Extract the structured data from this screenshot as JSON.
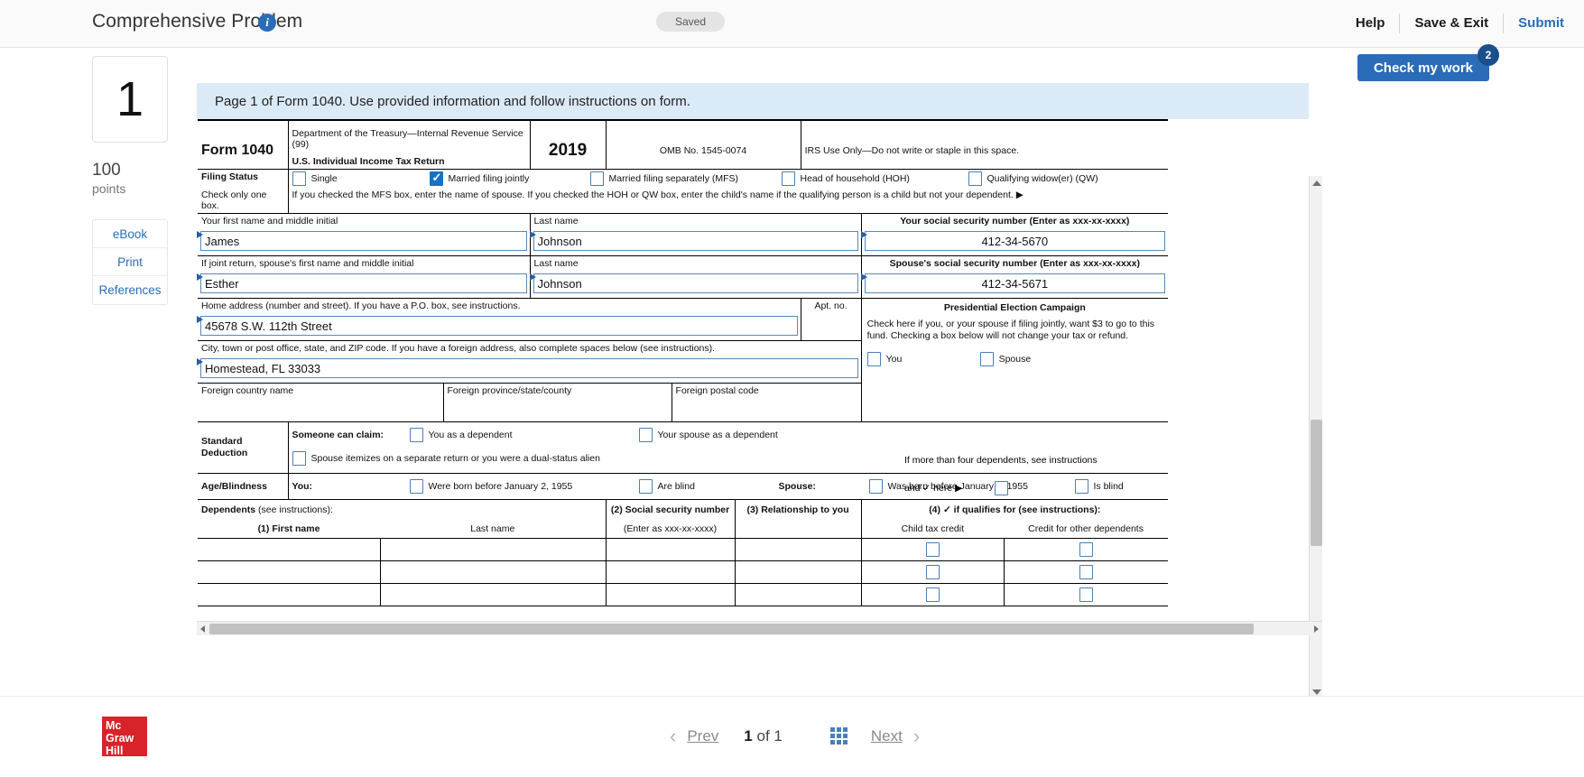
{
  "header": {
    "title": "Comprehensive Problem",
    "info_icon": "info-icon",
    "saved_label": "Saved",
    "nav": {
      "help": "Help",
      "save_exit": "Save & Exit",
      "submit": "Submit"
    }
  },
  "rail": {
    "question_number": "1",
    "points_value": "100",
    "points_label": "points",
    "buttons": [
      "eBook",
      "Print",
      "References"
    ]
  },
  "check_my_work": {
    "label": "Check my work",
    "badge": "2"
  },
  "banner": {
    "text": "Page 1 of Form 1040. Use provided information and follow instructions on form."
  },
  "form": {
    "title": "Form 1040",
    "dept_line1": "Department of the Treasury—Internal Revenue Service (99)",
    "dept_line2": "U.S. Individual Income Tax Return",
    "year": "2019",
    "omb": "OMB No. 1545-0074",
    "irs_use": "IRS Use Only—Do not write or staple in this space.",
    "filing_status": {
      "label": "Filing Status",
      "check_note": "Check only one box.",
      "instruction": "If you checked the MFS box, enter the name of spouse. If you checked the HOH or QW box, enter the child's name if the qualifying person is a child but not your dependent. ▶",
      "options": [
        {
          "label": "Single",
          "checked": false
        },
        {
          "label": "Married filing jointly",
          "checked": true
        },
        {
          "label": "Married filing separately (MFS)",
          "checked": false
        },
        {
          "label": "Head of household (HOH)",
          "checked": false
        },
        {
          "label": "Qualifying widow(er) (QW)",
          "checked": false
        }
      ]
    },
    "name_row": {
      "first_name_label": "Your first name and middle initial",
      "last_name_label": "Last name",
      "ssn_label": "Your social security number (Enter as xxx-xx-xxxx)",
      "first_name_value": "James",
      "last_name_value": "Johnson",
      "ssn_value": "412-34-5670"
    },
    "spouse_row": {
      "first_name_label": "If joint return, spouse's first name and middle initial",
      "last_name_label": "Last name",
      "ssn_label": "Spouse's social security number (Enter as xxx-xx-xxxx)",
      "first_name_value": "Esther",
      "last_name_value": "Johnson",
      "ssn_value": "412-34-5671"
    },
    "address_row": {
      "label": "Home address (number and street). If you have a P.O. box, see instructions.",
      "value": "45678 S.W. 112th Street",
      "apt_label": "Apt. no.",
      "apt_value": ""
    },
    "city_row": {
      "label": "City, town or post office, state, and ZIP code. If you have a foreign address, also complete spaces below (see instructions).",
      "value": "Homestead, FL 33033"
    },
    "pec": {
      "title": "Presidential Election Campaign",
      "text": "Check here if you, or your spouse if filing jointly, want $3 to go to this fund. Checking a box below will not change your tax or refund.",
      "you": "You",
      "spouse": "Spouse"
    },
    "foreign": {
      "country_label": "Foreign country name",
      "province_label": "Foreign province/state/county",
      "postal_label": "Foreign postal code",
      "country_value": "",
      "province_value": "",
      "postal_value": "",
      "more_deps": "If more than four dependents, see instructions",
      "and_check_here": "and ✓ here ▶"
    },
    "standard_deduction": {
      "label": "Standard Deduction",
      "someone_can_claim": "Someone can claim:",
      "you_dependent": "You as a dependent",
      "spouse_dependent": "Your spouse as a dependent",
      "spouse_itemizes": "Spouse itemizes on a separate return or you were a dual-status alien"
    },
    "age_blindness": {
      "label": "Age/Blindness",
      "you_label": "You:",
      "you_born": "Were born before January 2, 1955",
      "you_blind": "Are blind",
      "spouse_label": "Spouse:",
      "spouse_born": "Was born before January 2, 1955",
      "spouse_blind": "Is blind"
    },
    "dependents": {
      "title": "Dependents",
      "see_instructions": "(see instructions):",
      "col1": "(1) First name",
      "col1b": "Last name",
      "col2": "(2) Social security number",
      "col2b": "(Enter as xxx-xx-xxxx)",
      "col3": "(3) Relationship to you",
      "col4": "(4) ✓ if qualifies for (see instructions):",
      "col4a": "Child tax credit",
      "col4b": "Credit for other dependents",
      "rows": [
        {
          "first": "",
          "last": "",
          "ssn": "",
          "rel": ""
        },
        {
          "first": "",
          "last": "",
          "ssn": "",
          "rel": ""
        },
        {
          "first": "",
          "last": "",
          "ssn": "",
          "rel": ""
        }
      ]
    }
  },
  "footer": {
    "logo_line1": "Mc",
    "logo_line2": "Graw",
    "logo_line3": "Hill",
    "prev": "Prev",
    "page_current": "1",
    "page_of": "of",
    "page_total": "1",
    "next": "Next",
    "grid_icon": "grid-icon"
  },
  "colors": {
    "accent": "#2b6cb8",
    "banner": "#dbeaf7",
    "badge": "#1b4f8a",
    "logo": "#d8232a"
  }
}
